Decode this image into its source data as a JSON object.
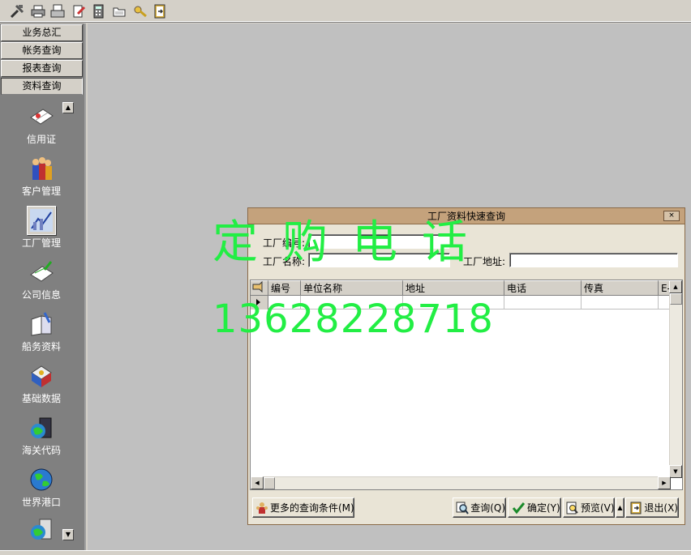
{
  "toolbar": {
    "icons": [
      "tools-icon",
      "print-icon",
      "print-preview-icon",
      "edit-doc-icon",
      "calculator-icon",
      "folder-icon",
      "key-icon",
      "exit-icon"
    ]
  },
  "nav": {
    "groups": [
      "业务总汇",
      "帐务查询",
      "报表查询",
      "资料查询"
    ],
    "items": [
      {
        "label": "信用证",
        "icon": "letter-of-credit-icon"
      },
      {
        "label": "客户管理",
        "icon": "customers-icon"
      },
      {
        "label": "工厂管理",
        "icon": "factory-icon"
      },
      {
        "label": "公司信息",
        "icon": "company-info-icon"
      },
      {
        "label": "船务资料",
        "icon": "shipping-docs-icon"
      },
      {
        "label": "基础数据",
        "icon": "base-data-icon"
      },
      {
        "label": "海关代码",
        "icon": "customs-code-icon"
      },
      {
        "label": "世界港口",
        "icon": "world-ports-icon"
      },
      {
        "label": "",
        "icon": "more-icon"
      }
    ]
  },
  "dialog": {
    "title": "工厂资料快速查询",
    "close_label": "×",
    "factory_no_label": "工厂编号:",
    "factory_no_value": "",
    "factory_name_label": "工厂名称:",
    "factory_name_value": "",
    "factory_addr_label": "工厂地址:",
    "factory_addr_value": "",
    "grid": {
      "columns": [
        "编号",
        "单位名称",
        "地址",
        "电话",
        "传真",
        "E-M"
      ],
      "rows": []
    },
    "buttons": {
      "more_conditions": "更多的查询条件(M)",
      "query": "查询(Q)",
      "confirm": "确定(Y)",
      "preview": "预览(V)",
      "exit": "退出(X)"
    }
  },
  "watermark": {
    "line1": "定购电话",
    "line2": "13628228718"
  }
}
